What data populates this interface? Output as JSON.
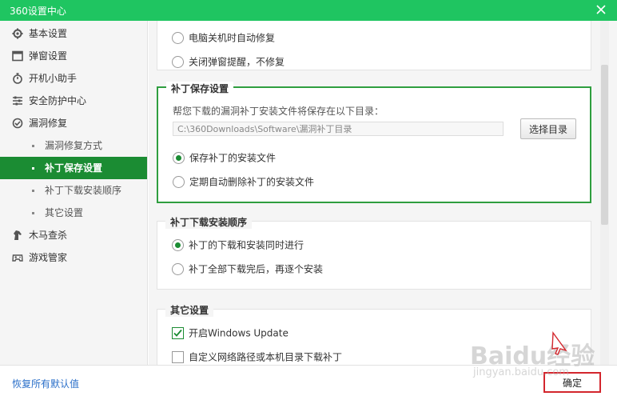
{
  "window": {
    "title": "360设置中心"
  },
  "sidebar": {
    "items": [
      {
        "label": "基本设置",
        "icon": "gear-icon"
      },
      {
        "label": "弹窗设置",
        "icon": "window-icon"
      },
      {
        "label": "开机小助手",
        "icon": "stopwatch-icon"
      },
      {
        "label": "安全防护中心",
        "icon": "sliders-icon"
      },
      {
        "label": "漏洞修复",
        "icon": "patch-icon"
      }
    ],
    "subitems": [
      {
        "label": "漏洞修复方式"
      },
      {
        "label": "补丁保存设置"
      },
      {
        "label": "补丁下载安装顺序"
      },
      {
        "label": "其它设置"
      }
    ],
    "items2": [
      {
        "label": "木马查杀",
        "icon": "horse-icon"
      },
      {
        "label": "游戏管家",
        "icon": "gamepad-icon"
      }
    ]
  },
  "repair_section": {
    "options": [
      {
        "label": "电脑关机时自动修复",
        "selected": false
      },
      {
        "label": "关闭弹窗提醒，不修复",
        "selected": false
      }
    ]
  },
  "save_section": {
    "title": "补丁保存设置",
    "description": "帮您下载的漏洞补丁安装文件将保存在以下目录：",
    "path_value": "C:\\360Downloads\\Software\\漏洞补丁目录",
    "choose_dir_label": "选择目录",
    "options": [
      {
        "label": "保存补丁的安装文件",
        "selected": true
      },
      {
        "label": "定期自动删除补丁的安装文件",
        "selected": false
      }
    ]
  },
  "order_section": {
    "title": "补丁下载安装顺序",
    "options": [
      {
        "label": "补丁的下载和安装同时进行",
        "selected": true
      },
      {
        "label": "补丁全部下载完后，再逐个安装",
        "selected": false
      }
    ]
  },
  "other_section": {
    "title": "其它设置",
    "options": [
      {
        "label": "开启Windows Update",
        "checked": true
      },
      {
        "label": "自定义网络路径或本机目录下载补丁",
        "checked": false
      }
    ]
  },
  "footer": {
    "restore_label": "恢复所有默认值",
    "ok_label": "确定"
  },
  "watermark": {
    "brand": "Baidu经验",
    "url": "jingyan.baidu.com"
  },
  "colors": {
    "titlebar": "#1fc561",
    "accent": "#1b8c33",
    "highlight": "#d3262d",
    "link": "#2a6fc9"
  }
}
